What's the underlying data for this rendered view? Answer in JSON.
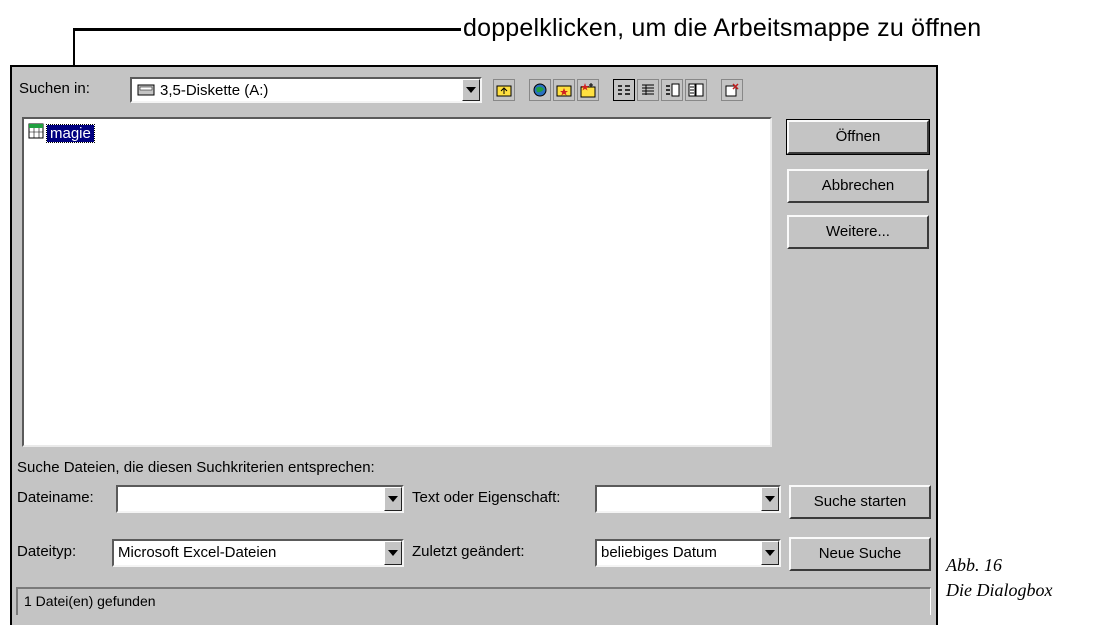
{
  "callout": {
    "text": "doppelklicken, um die Arbeitsmappe zu öffnen"
  },
  "dialog": {
    "look_in_label": "Suchen in:",
    "look_in_value": "3,5-Diskette (A:)",
    "files": [
      {
        "name": "magie"
      }
    ],
    "buttons": {
      "open": "Öffnen",
      "cancel": "Abbrechen",
      "more": "Weitere...",
      "start_search": "Suche starten",
      "new_search": "Neue Suche"
    },
    "criteria_heading": "Suche Dateien, die diesen Suchkriterien entsprechen:",
    "filename_label": "Dateiname:",
    "filename_value": "",
    "text_property_label": "Text oder Eigenschaft:",
    "text_property_value": "",
    "filetype_label": "Dateityp:",
    "filetype_value": "Microsoft Excel-Dateien",
    "last_modified_label": "Zuletzt geändert:",
    "last_modified_value": "beliebiges Datum",
    "status": "1 Datei(en) gefunden"
  },
  "caption": {
    "line1": "Abb. 16",
    "line2": "Die Dialogbox"
  },
  "icons": {
    "toolbar": [
      "up-folder-icon",
      "internet-search-icon",
      "favorites-icon",
      "add-favorites-icon",
      "list-view-icon",
      "details-view-icon",
      "properties-view-icon",
      "preview-view-icon",
      "commands-icon"
    ],
    "drive": "floppy-drive-icon",
    "file": "excel-workbook-icon"
  }
}
